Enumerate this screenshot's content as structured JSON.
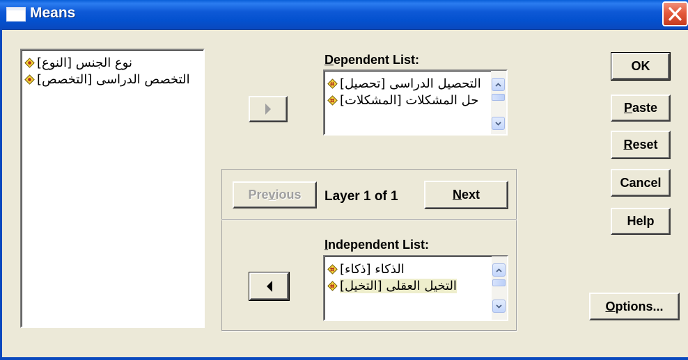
{
  "window": {
    "title": "Means"
  },
  "source_list": {
    "items": [
      {
        "label": "نوع الجنس [النوع]",
        "icon": "nominal-variable-icon"
      },
      {
        "label": "التخصص الدراسى [التخصص]",
        "icon": "nominal-variable-icon"
      }
    ]
  },
  "dependent": {
    "label_prefix": "D",
    "label_rest": "ependent List:",
    "items": [
      {
        "label": "التحصيل الدراسى [تحصيل]",
        "icon": "scale-variable-icon"
      },
      {
        "label": "حل المشكلات [المشكلات]",
        "icon": "scale-variable-icon"
      }
    ]
  },
  "layer": {
    "previous_label": "Previous",
    "previous_prefix": "Pre",
    "previous_ul": "v",
    "previous_rest": "ious",
    "status": "Layer 1 of 1",
    "next_ul": "N",
    "next_rest": "ext"
  },
  "independent": {
    "label_prefix": "I",
    "label_rest": "ndependent List:",
    "items": [
      {
        "label": "الذكاء [ذكاء]",
        "icon": "scale-variable-icon"
      },
      {
        "label": "التخيل العقلى [التخيل]",
        "icon": "scale-variable-icon"
      }
    ]
  },
  "buttons": {
    "ok": "OK",
    "paste_ul": "P",
    "paste_rest": "aste",
    "reset_ul": "R",
    "reset_rest": "eset",
    "cancel": "Cancel",
    "help": "Help",
    "options_ul": "O",
    "options_rest": "ptions..."
  },
  "colors": {
    "titlebar": "#0451cf",
    "dialog_bg": "#ece9d8",
    "close_button": "#e45a3c",
    "variable_icon_fill": "#f2d23a"
  }
}
